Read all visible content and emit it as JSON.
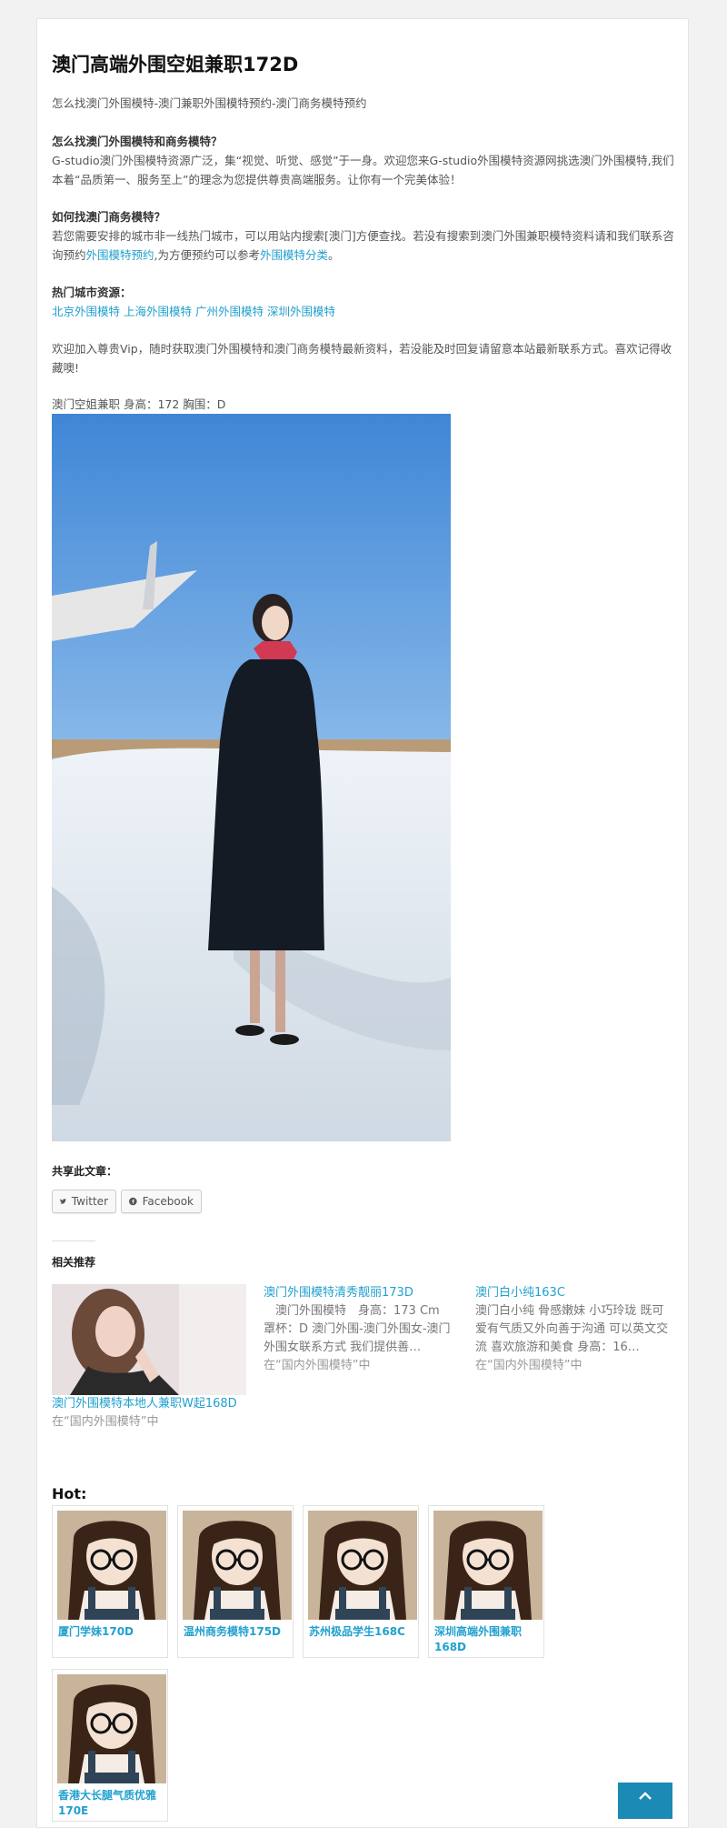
{
  "article": {
    "title": "澳门高端外围空姐兼职172D",
    "subtitle": "怎么找澳门外围模特-澳门兼职外围模特预约-澳门商务模特预约",
    "section1_heading": "怎么找澳门外围模特和商务模特？",
    "section1_text": "G-studio澳门外围模特资源广泛，集“视觉、听觉、感觉”于一身。欢迎您来G-studio外围模特资源网挑选澳门外围模特,我们本着“品质第一、服务至上”的理念为您提供尊贵高端服务。让你有一个完美体验！",
    "section2_heading": "如何找澳门商务模特？",
    "section2_text_a": "若您需要安排的城市非一线热门城市，可以用站内搜索[澳门]方便查找。若没有搜索到澳门外围兼职模特资料请和我们联系咨询预约",
    "section2_link1": "外围模特预约",
    "section2_text_b": ",为方便预约可以参考",
    "section2_link2": "外围模特分类",
    "section2_text_c": "。",
    "section3_heading": "热门城市资源：",
    "city_links": [
      "北京外围模特",
      "上海外围模特",
      "广州外围模特",
      "深圳外围模特"
    ],
    "vip_text": "欢迎加入尊贵Vip，随时获取澳门外围模特和澳门商务模特最新资料，若没能及时回复请留意本站最新联系方式。喜欢记得收藏噢!",
    "model_info": "澳门空姐兼职 身高：172 胸围：D"
  },
  "share": {
    "title": "共享此文章：",
    "twitter": "Twitter",
    "facebook": "Facebook"
  },
  "related": {
    "title": "相关推荐",
    "items": [
      {
        "title": "澳门外围模特本地人兼职W起168D",
        "excerpt": "",
        "category": "在“国内外围模特”中"
      },
      {
        "title": "澳门外围模特清秀靓丽173D",
        "excerpt": "　澳门外围模特　身高：173 Cm　罩杯：D 澳门外围-澳门外围女-澳门外围女联系方式 我们提供善…",
        "category": "在“国内外围模特”中"
      },
      {
        "title": "澳门白小纯163C",
        "excerpt": "澳门白小纯 骨感嫩妹 小巧玲珑 既可爱有气质又外向善于沟通 可以英文交流 喜欢旅游和美食 身高：16…",
        "category": "在“国内外围模特”中"
      }
    ]
  },
  "hot": {
    "title": "Hot:",
    "items": [
      {
        "label": "厦门学妹170D"
      },
      {
        "label": "温州商务模特175D"
      },
      {
        "label": "苏州极品学生168C"
      },
      {
        "label": "深圳高端外围兼职168D"
      },
      {
        "label": "香港大长腿气质优雅170E"
      }
    ]
  },
  "colors": {
    "link": "#21a0ce",
    "back_to_top": "#1b8ab4"
  }
}
